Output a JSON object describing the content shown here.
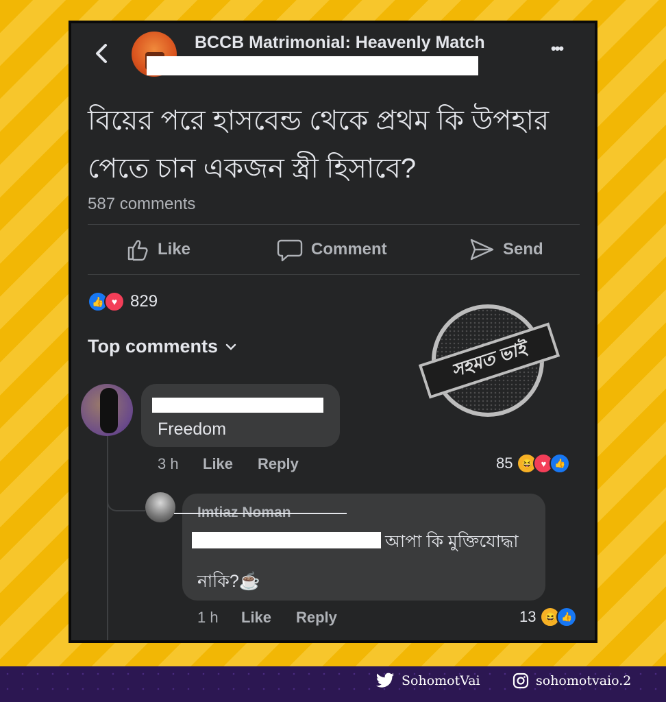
{
  "header": {
    "page_name": "BCCB Matrimonial: Heavenly Match",
    "more_label": "•••"
  },
  "post": {
    "text_line1": "বিয়ের পরে হাসবেন্ড থেকে প্রথম কি উপহার",
    "text_line2": "পেতে চান একজন স্ত্রী হিসাবে?",
    "comment_count": "587 comments"
  },
  "actions": {
    "like": "Like",
    "comment": "Comment",
    "send": "Send"
  },
  "reactions": {
    "count": "829"
  },
  "comments_header": "Top comments",
  "comment1": {
    "text": "Freedom",
    "time": "3 h",
    "like": "Like",
    "reply": "Reply",
    "reaction_count": "85"
  },
  "reply1": {
    "author": "Imtiaz Noman",
    "text_line1": "আপা কি মুক্তিযোদ্ধা",
    "text_line2": "নাকি?☕",
    "time": "1 h",
    "like": "Like",
    "reply": "Reply",
    "reaction_count": "13"
  },
  "watermark": {
    "text": "সহমত ভাই"
  },
  "footer": {
    "twitter_handle": "SohomotVai",
    "instagram_handle": "sohomotvaio.2"
  },
  "colors": {
    "background_stripe": "#f2b705",
    "screen": "#242526",
    "bubble": "#3a3b3c",
    "like_blue": "#1877f2",
    "love_red": "#f33e58",
    "footer": "#2c1752"
  }
}
